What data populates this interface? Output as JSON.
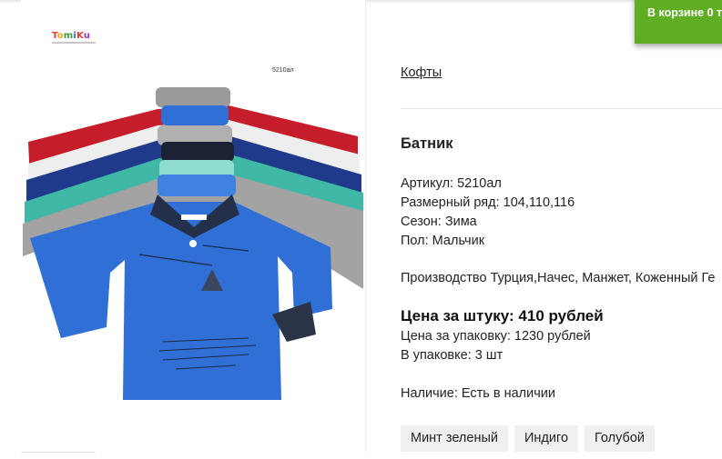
{
  "cart": {
    "label": "В корзине 0 т"
  },
  "image": {
    "brand": [
      "T",
      "o",
      "m",
      "i",
      "K",
      "u"
    ],
    "code": "5210ал",
    "colors": {
      "red": "#c51d2a",
      "gray": "#9a9a9a",
      "navy": "#1f3a8a",
      "mint": "#3fb8a5",
      "royal": "#2f6fd6",
      "dark": "#24304a",
      "cuff": "#2a3446",
      "white": "#f2f2f2"
    }
  },
  "product": {
    "category": "Кофты",
    "title": "Батник",
    "specs": [
      "Артикул: 5210ал",
      "Размерный ряд: 104,110,116",
      "Сезон: Зима",
      "Пол: Мальчик"
    ],
    "description": "Производство Турция,Начес, Манжет, Коженный Ге",
    "price_unit": "Цена за штуку: 410 рублей",
    "price_pack": "Цена за упаковку: 1230 рублей",
    "pack_qty": "В упаковке: 3 шт",
    "availability": "Наличие: Есть в наличии",
    "variants": [
      "Минт зеленый",
      "Индиго",
      "Голубой"
    ]
  }
}
